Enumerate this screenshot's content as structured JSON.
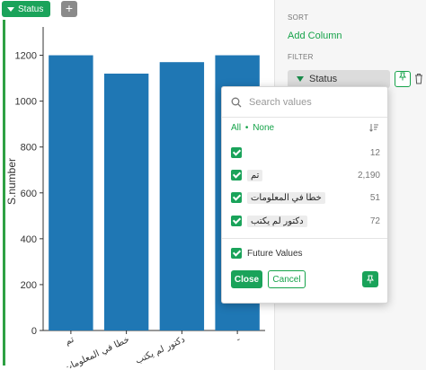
{
  "toolbar": {
    "status_chip": "Status",
    "add_symbol": "+"
  },
  "sidebar": {
    "sort_heading": "SORT",
    "add_column": "Add Column",
    "filter_heading": "FILTER",
    "filter_field": "Status"
  },
  "popup": {
    "search_placeholder": "Search values",
    "all_label": "All",
    "separator": "•",
    "none_label": "None",
    "options": [
      {
        "label": "",
        "count": "12",
        "checked": true
      },
      {
        "label": "تم",
        "count": "2,190",
        "checked": true
      },
      {
        "label": "خطا في المعلومات",
        "count": "51",
        "checked": true
      },
      {
        "label": "دكتور لم يكتب",
        "count": "72",
        "checked": true
      }
    ],
    "future_values": "Future Values",
    "close_label": "Close",
    "cancel_label": "Cancel"
  },
  "chart_data": {
    "type": "bar",
    "categories": [
      "تم",
      "خطا في المعلومات",
      "دكتور لم يكتب",
      "-"
    ],
    "values": [
      1200,
      1120,
      1170,
      1200
    ],
    "ylabel": "S.number",
    "xlabel": "",
    "ylim": [
      0,
      1300
    ],
    "yticks": [
      0,
      200,
      400,
      600,
      800,
      1000,
      1200
    ],
    "bar_color": "#1f77b4"
  },
  "colors": {
    "accent_green": "#1aa35a",
    "bar": "#1f77b4"
  }
}
